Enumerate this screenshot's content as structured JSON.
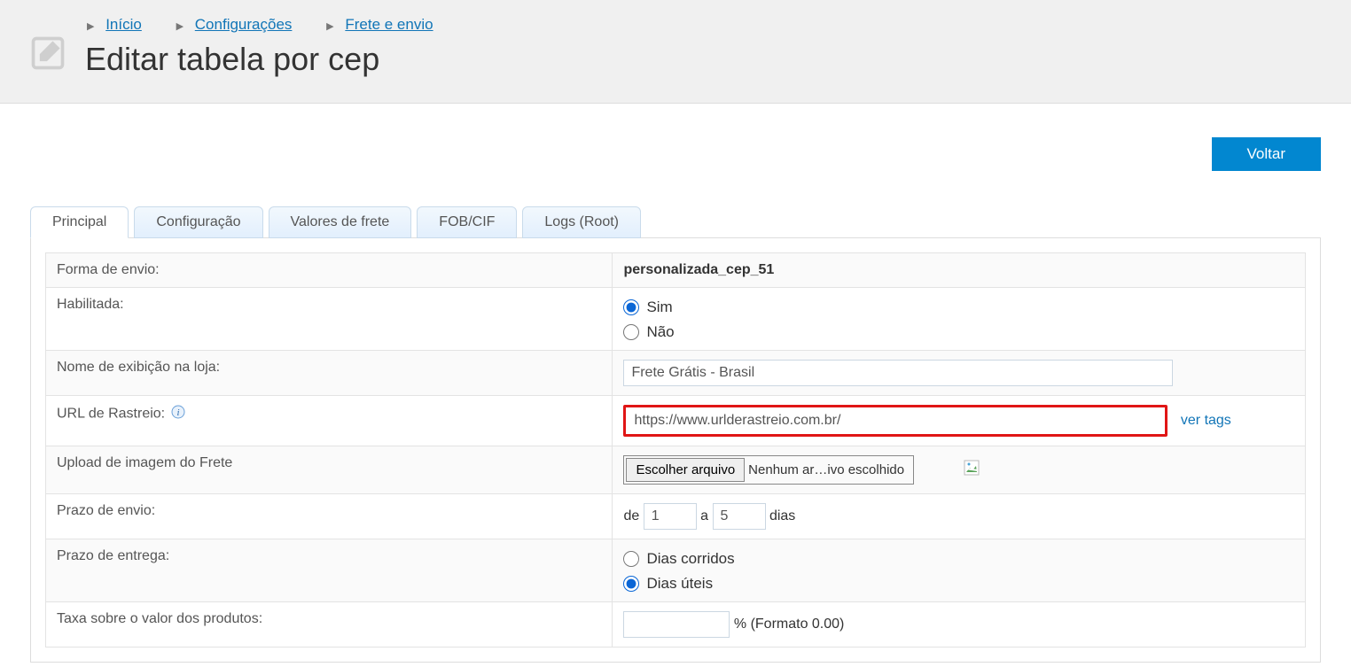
{
  "breadcrumb": {
    "inicio": "Início",
    "config": "Configurações",
    "frete": "Frete e envio"
  },
  "page_title": "Editar tabela por cep",
  "buttons": {
    "voltar": "Voltar",
    "escolher_arquivo": "Escolher arquivo"
  },
  "tabs": {
    "principal": "Principal",
    "configuracao": "Configuração",
    "valores": "Valores de frete",
    "fobcif": "FOB/CIF",
    "logs": "Logs (Root)"
  },
  "labels": {
    "forma_envio": "Forma de envio:",
    "habilitada": "Habilitada:",
    "nome_exibicao": "Nome de exibição na loja:",
    "url_rastreio": "URL de Rastreio:",
    "upload_imagem": "Upload de imagem do Frete",
    "prazo_envio": "Prazo de envio:",
    "prazo_entrega": "Prazo de entrega:",
    "taxa_valor": "Taxa sobre o valor dos produtos:"
  },
  "values": {
    "forma_envio": "personalizada_cep_51",
    "sim": "Sim",
    "nao": "Não",
    "nome_exibicao": "Frete Grátis - Brasil",
    "url_rastreio": "https://www.urlderastreio.com.br/",
    "ver_tags": "ver tags",
    "file_status": "Nenhum ar…ivo escolhido",
    "prazo_de": "de",
    "prazo_a": "a",
    "prazo_dias": "dias",
    "prazo_min": "1",
    "prazo_max": "5",
    "dias_corridos": "Dias corridos",
    "dias_uteis": "Dias úteis",
    "taxa_formato": "% (Formato 0.00)"
  }
}
